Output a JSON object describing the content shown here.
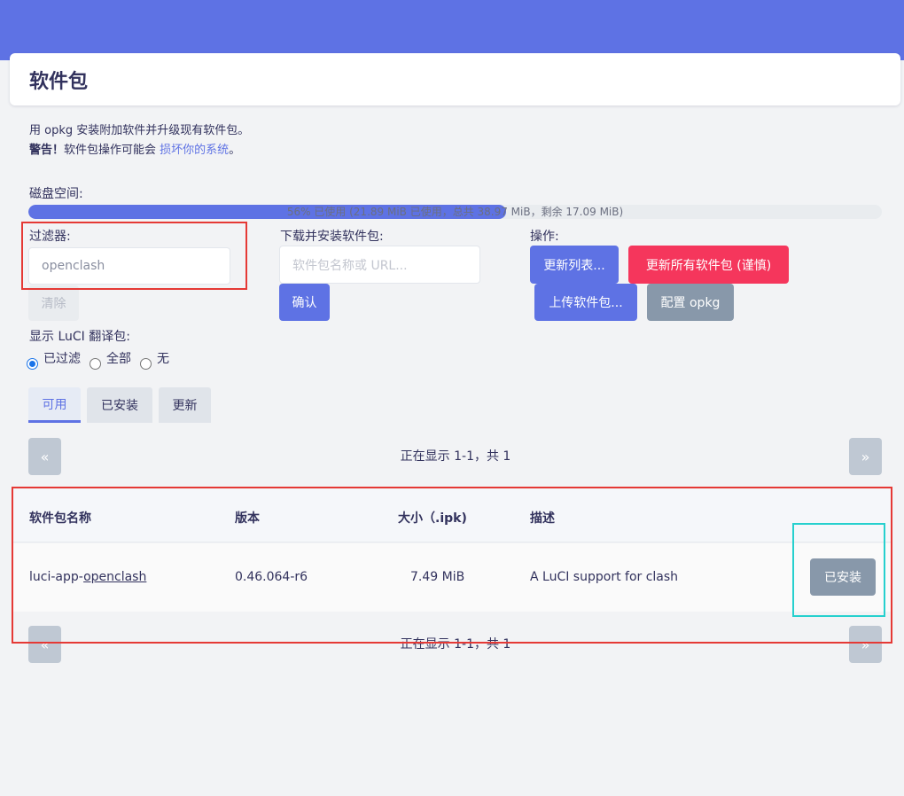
{
  "page": {
    "title": "软件包",
    "description_line1": "用 opkg 安装附加软件并升级现有软件包。",
    "warning_prefix": "警告！",
    "warning_text": "软件包操作可能会",
    "warning_link": "损坏你的系统",
    "warning_suffix": "。"
  },
  "disk": {
    "label": "磁盘空间:",
    "used_percent": 56,
    "text": "56% 已使用 (21.89 MiB 已使用，总共 38.97 MiB，剩余 17.09 MiB)"
  },
  "filter": {
    "label": "过滤器:",
    "value": "openclash",
    "clear_label": "清除"
  },
  "download": {
    "label": "下载并安装软件包:",
    "placeholder": "软件包名称或 URL...",
    "confirm_label": "确认"
  },
  "actions": {
    "label": "操作:",
    "update_list": "更新列表...",
    "upgrade_all": "更新所有软件包 (谨慎)",
    "upload": "上传软件包...",
    "configure": "配置 opkg"
  },
  "luci_translation": {
    "label": "显示 LuCI 翻译包:",
    "options": [
      "已过滤",
      "全部",
      "无"
    ],
    "selected": "已过滤"
  },
  "tabs": [
    "可用",
    "已安装",
    "更新"
  ],
  "active_tab": "可用",
  "pager": {
    "prev": "«",
    "next": "»",
    "status": "正在显示 1-1，共 1"
  },
  "table": {
    "headers": [
      "软件包名称",
      "版本",
      "大小（.ipk)",
      "描述"
    ],
    "rows": [
      {
        "name_prefix": "luci-app-",
        "name_underlined": "openclash",
        "version": "0.46.064-r6",
        "size": "7.49 MiB",
        "description": "A LuCI support for clash",
        "action": "已安装"
      }
    ]
  },
  "colors": {
    "accent": "#5e72e4",
    "danger": "#f5365c",
    "gray_button": "#8898aa",
    "highlight_red": "#e53935",
    "highlight_cyan": "#26d0ce"
  }
}
